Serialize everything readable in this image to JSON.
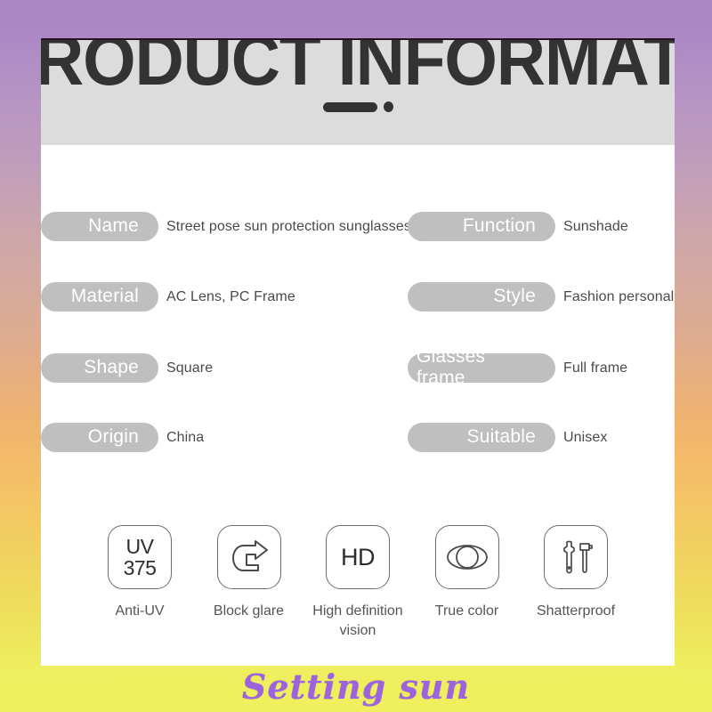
{
  "card": {
    "header": {
      "title": "PRODUCT INFORMATION",
      "rule_bar": "",
      "rule_dot": ""
    },
    "specs": {
      "left": [
        {
          "label": "Name",
          "value": "Street pose sun protection sunglasses"
        },
        {
          "label": "Material",
          "value": "AC Lens, PC Frame"
        },
        {
          "label": "Shape",
          "value": "Square"
        },
        {
          "label": "Origin",
          "value": "China"
        }
      ],
      "right": [
        {
          "label": "Function",
          "value": "Sunshade"
        },
        {
          "label": "Style",
          "value": "Fashion personality"
        },
        {
          "label": "Glasses frame",
          "value": "Full frame"
        },
        {
          "label": "Suitable",
          "value": "Unisex"
        }
      ]
    },
    "features": [
      {
        "icon": "uv-375-icon",
        "glyph_line1": "UV",
        "glyph_line2": "375",
        "label": "Anti-UV"
      },
      {
        "icon": "u-turn-arrow-icon",
        "glyph_line1": "",
        "glyph_line2": "",
        "label": "Block glare"
      },
      {
        "icon": "hd-icon",
        "glyph_line1": "HD",
        "glyph_line2": "",
        "label": "High definition vision"
      },
      {
        "icon": "overlapping-lens-icon",
        "glyph_line1": "",
        "glyph_line2": "",
        "label": "True color"
      },
      {
        "icon": "wrench-hammer-icon",
        "glyph_line1": "",
        "glyph_line2": "",
        "label": "Shatterproof"
      }
    ]
  },
  "watermark": {
    "text": "Setting sun"
  },
  "colors": {
    "background_top": "#ab87c6",
    "background_mid": "#f0b06e",
    "background_bottom": "#f0f05f",
    "card_background": "#ffffff",
    "header_band": "#dcdcdc",
    "pill": "#bfbfbf",
    "pill_text": "#ffffff",
    "value_text": "#4a4a4a",
    "title_text": "#333333",
    "icon_stroke": "#6d6d6d",
    "watermark_text": "#9b63dc"
  }
}
